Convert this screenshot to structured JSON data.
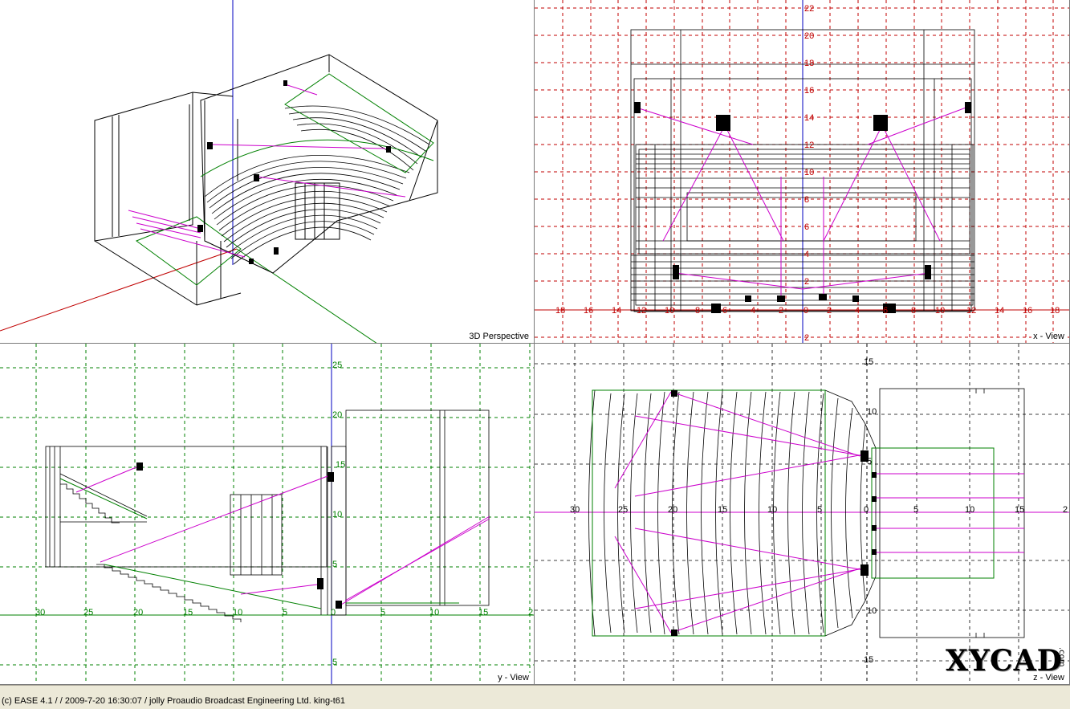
{
  "viewports": {
    "perspective": {
      "label": "3D Perspective"
    },
    "x_view": {
      "label": "x - View",
      "h_ticks": [
        "18",
        "16",
        "14",
        "12",
        "10",
        "8",
        "6",
        "4",
        "2",
        "0",
        "2",
        "4",
        "6",
        "8",
        "10",
        "12",
        "14",
        "16",
        "18"
      ],
      "v_ticks": [
        "22",
        "20",
        "18",
        "16",
        "14",
        "12",
        "10",
        "8",
        "6",
        "4",
        "2",
        "2"
      ]
    },
    "y_view": {
      "label": "y - View",
      "h_ticks": [
        "30",
        "25",
        "20",
        "15",
        "10",
        "5",
        "0",
        "5",
        "10",
        "15",
        "2"
      ],
      "v_ticks": [
        "25",
        "20",
        "15",
        "10",
        "5",
        "5"
      ]
    },
    "z_view": {
      "label": "z - View",
      "h_ticks": [
        "30",
        "25",
        "20",
        "15",
        "10",
        "5",
        "0",
        "5",
        "10",
        "15",
        "2"
      ],
      "v_ticks": [
        "15",
        "10",
        "5",
        "10",
        "15"
      ]
    }
  },
  "status_bar": {
    "text": "(c) EASE 4.1  /   / 2009-7-20 16:30:07 / jolly Proaudio Broadcast Engineering Ltd. king-t61"
  },
  "watermark": {
    "text": "XYCAD",
    "suffix": ".com"
  },
  "colors": {
    "grid_red": "#c00000",
    "grid_green": "#008000",
    "axis_blue": "#0000c0",
    "loudspeaker_ray": "#cc00cc",
    "model_line": "#000000",
    "stage_outline": "#008000"
  }
}
